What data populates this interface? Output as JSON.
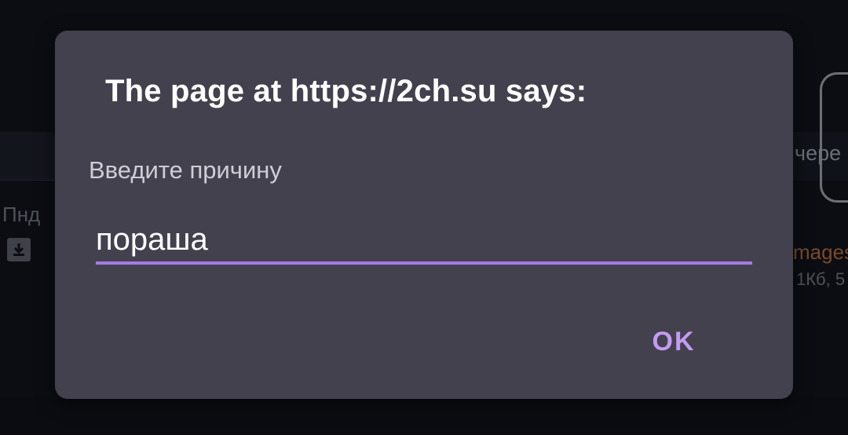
{
  "background": {
    "date_fragment": "Пнд",
    "side_text_fragment": "чере",
    "link_fragment": "mages",
    "meta_fragment": "1Кб, 5",
    "download_icon": "download-icon"
  },
  "dialog": {
    "title": "The page at https://2ch.su says:",
    "message": "Введите причину",
    "input_value": "пораша",
    "ok_label": "OK",
    "accent_color": "#a47be6"
  }
}
